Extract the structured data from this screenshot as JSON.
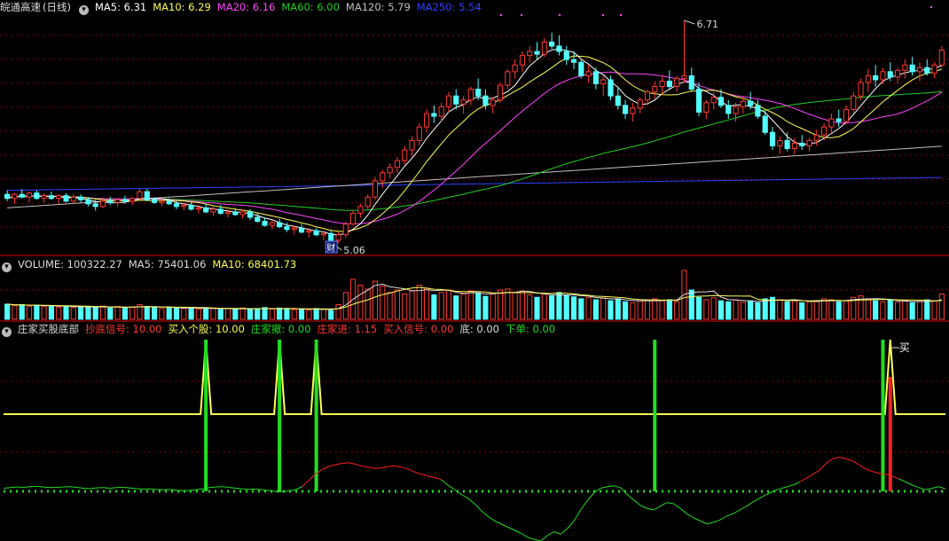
{
  "colors": {
    "up": "#ff3b30",
    "down": "#54ffff",
    "ma5": "#ffffff",
    "ma10": "#ffff55",
    "ma20": "#ff44ff",
    "ma60": "#22cc22",
    "ma120": "#c0c0c0",
    "ma250": "#3040ff",
    "grid": "#8b0000",
    "separator": "#b00000"
  },
  "price_panel": {
    "title": "皖通高速",
    "period": "(日线)",
    "ma": [
      {
        "label": "MA5: 6.31",
        "color": "#ffffff"
      },
      {
        "label": "MA10: 6.29",
        "color": "#ffff55"
      },
      {
        "label": "MA20: 6.16",
        "color": "#ff44ff"
      },
      {
        "label": "MA60: 6.00",
        "color": "#22cc22"
      },
      {
        "label": "MA120: 5.79",
        "color": "#c0c0c0"
      },
      {
        "label": "MA250: 5.54",
        "color": "#3040ff"
      }
    ],
    "high_label": "6.71",
    "low_label": "5.06",
    "event_label": "财"
  },
  "volume_panel": {
    "items": [
      {
        "label": "VOLUME: 100322.27",
        "color": "#dddddd"
      },
      {
        "label": "MA5: 75401.06",
        "color": "#dddddd"
      },
      {
        "label": "MA10: 68401.73",
        "color": "#ffff55"
      }
    ]
  },
  "indicator_panel": {
    "title": "庄家买股底部",
    "items": [
      {
        "label": "抄底信号: 10.00",
        "color": "#ff3b30"
      },
      {
        "label": "买入个股: 10.00",
        "color": "#ffff55"
      },
      {
        "label": "庄家撤: 0.00",
        "color": "#22dd22"
      },
      {
        "label": "庄家进: 1.15",
        "color": "#ff3b30"
      },
      {
        "label": "买入信号: 0.00",
        "color": "#ff3b30"
      },
      {
        "label": "底: 0.00",
        "color": "#dddddd"
      },
      {
        "label": "下单: 0.00",
        "color": "#22dd22"
      }
    ],
    "buy_label": "买"
  },
  "chart_data": {
    "type": "candlestick",
    "y_range": [
      5.0,
      6.75
    ],
    "candles": [
      [
        5.42,
        5.45,
        5.37,
        5.39
      ],
      [
        5.39,
        5.43,
        5.35,
        5.42
      ],
      [
        5.42,
        5.46,
        5.39,
        5.4
      ],
      [
        5.4,
        5.44,
        5.36,
        5.43
      ],
      [
        5.43,
        5.45,
        5.38,
        5.39
      ],
      [
        5.39,
        5.43,
        5.36,
        5.41
      ],
      [
        5.41,
        5.44,
        5.38,
        5.39
      ],
      [
        5.39,
        5.42,
        5.35,
        5.41
      ],
      [
        5.41,
        5.43,
        5.36,
        5.37
      ],
      [
        5.37,
        5.42,
        5.35,
        5.4
      ],
      [
        5.4,
        5.42,
        5.36,
        5.38
      ],
      [
        5.38,
        5.4,
        5.33,
        5.35
      ],
      [
        5.35,
        5.38,
        5.3,
        5.33
      ],
      [
        5.33,
        5.39,
        5.32,
        5.37
      ],
      [
        5.37,
        5.4,
        5.34,
        5.36
      ],
      [
        5.36,
        5.39,
        5.33,
        5.38
      ],
      [
        5.38,
        5.41,
        5.35,
        5.37
      ],
      [
        5.37,
        5.4,
        5.34,
        5.39
      ],
      [
        5.39,
        5.46,
        5.38,
        5.44
      ],
      [
        5.44,
        5.46,
        5.37,
        5.38
      ],
      [
        5.38,
        5.4,
        5.35,
        5.36
      ],
      [
        5.36,
        5.39,
        5.33,
        5.37
      ],
      [
        5.37,
        5.39,
        5.34,
        5.35
      ],
      [
        5.35,
        5.37,
        5.31,
        5.33
      ],
      [
        5.33,
        5.36,
        5.3,
        5.34
      ],
      [
        5.34,
        5.36,
        5.3,
        5.31
      ],
      [
        5.31,
        5.34,
        5.28,
        5.32
      ],
      [
        5.32,
        5.35,
        5.28,
        5.29
      ],
      [
        5.29,
        5.33,
        5.26,
        5.31
      ],
      [
        5.31,
        5.34,
        5.27,
        5.28
      ],
      [
        5.28,
        5.31,
        5.25,
        5.29
      ],
      [
        5.29,
        5.32,
        5.26,
        5.27
      ],
      [
        5.27,
        5.31,
        5.24,
        5.29
      ],
      [
        5.29,
        5.31,
        5.23,
        5.25
      ],
      [
        5.25,
        5.28,
        5.21,
        5.22
      ],
      [
        5.22,
        5.25,
        5.18,
        5.19
      ],
      [
        5.19,
        5.23,
        5.16,
        5.21
      ],
      [
        5.21,
        5.24,
        5.17,
        5.18
      ],
      [
        5.18,
        5.21,
        5.14,
        5.16
      ],
      [
        5.16,
        5.19,
        5.12,
        5.17
      ],
      [
        5.17,
        5.2,
        5.13,
        5.14
      ],
      [
        5.14,
        5.17,
        5.1,
        5.15
      ],
      [
        5.15,
        5.17,
        5.11,
        5.12
      ],
      [
        5.12,
        5.15,
        5.08,
        5.13
      ],
      [
        5.13,
        5.15,
        5.06,
        5.08
      ],
      [
        5.08,
        5.14,
        5.06,
        5.12
      ],
      [
        5.12,
        5.22,
        5.1,
        5.2
      ],
      [
        5.2,
        5.3,
        5.19,
        5.28
      ],
      [
        5.28,
        5.35,
        5.25,
        5.33
      ],
      [
        5.33,
        5.42,
        5.31,
        5.4
      ],
      [
        5.4,
        5.55,
        5.38,
        5.52
      ],
      [
        5.52,
        5.6,
        5.47,
        5.58
      ],
      [
        5.58,
        5.65,
        5.54,
        5.62
      ],
      [
        5.62,
        5.7,
        5.58,
        5.67
      ],
      [
        5.67,
        5.78,
        5.64,
        5.75
      ],
      [
        5.75,
        5.85,
        5.7,
        5.82
      ],
      [
        5.82,
        5.95,
        5.78,
        5.92
      ],
      [
        5.92,
        6.05,
        5.88,
        6.02
      ],
      [
        6.02,
        6.08,
        5.95,
        6.0
      ],
      [
        6.0,
        6.1,
        5.96,
        6.07
      ],
      [
        6.07,
        6.18,
        6.03,
        6.15
      ],
      [
        6.15,
        6.2,
        6.05,
        6.09
      ],
      [
        6.09,
        6.15,
        6.02,
        6.12
      ],
      [
        6.12,
        6.22,
        6.08,
        6.2
      ],
      [
        6.2,
        6.28,
        6.12,
        6.15
      ],
      [
        6.15,
        6.2,
        6.05,
        6.08
      ],
      [
        6.08,
        6.14,
        6.02,
        6.12
      ],
      [
        6.12,
        6.25,
        6.1,
        6.23
      ],
      [
        6.23,
        6.35,
        6.2,
        6.33
      ],
      [
        6.33,
        6.42,
        6.28,
        6.38
      ],
      [
        6.38,
        6.48,
        6.33,
        6.45
      ],
      [
        6.45,
        6.52,
        6.4,
        6.48
      ],
      [
        6.48,
        6.55,
        6.42,
        6.46
      ],
      [
        6.46,
        6.58,
        6.44,
        6.55
      ],
      [
        6.55,
        6.62,
        6.5,
        6.52
      ],
      [
        6.52,
        6.6,
        6.45,
        6.48
      ],
      [
        6.48,
        6.52,
        6.38,
        6.42
      ],
      [
        6.42,
        6.48,
        6.35,
        6.4
      ],
      [
        6.4,
        6.42,
        6.28,
        6.3
      ],
      [
        6.3,
        6.38,
        6.25,
        6.33
      ],
      [
        6.33,
        6.36,
        6.2,
        6.24
      ],
      [
        6.24,
        6.3,
        6.15,
        6.27
      ],
      [
        6.27,
        6.3,
        6.12,
        6.15
      ],
      [
        6.15,
        6.22,
        6.05,
        6.08
      ],
      [
        6.08,
        6.12,
        5.98,
        6.02
      ],
      [
        6.02,
        6.1,
        5.96,
        6.06
      ],
      [
        6.06,
        6.14,
        6.02,
        6.12
      ],
      [
        6.12,
        6.2,
        6.08,
        6.18
      ],
      [
        6.18,
        6.26,
        6.13,
        6.22
      ],
      [
        6.22,
        6.3,
        6.16,
        6.26
      ],
      [
        6.26,
        6.34,
        6.2,
        6.22
      ],
      [
        6.22,
        6.3,
        6.18,
        6.28
      ],
      [
        6.28,
        6.71,
        6.25,
        6.3
      ],
      [
        6.3,
        6.36,
        6.18,
        6.2
      ],
      [
        6.2,
        6.25,
        6.0,
        6.03
      ],
      [
        6.03,
        6.12,
        5.98,
        6.1
      ],
      [
        6.1,
        6.18,
        6.05,
        6.14
      ],
      [
        6.14,
        6.2,
        6.06,
        6.08
      ],
      [
        6.08,
        6.12,
        5.98,
        6.02
      ],
      [
        6.02,
        6.1,
        5.96,
        6.07
      ],
      [
        6.07,
        6.15,
        6.02,
        6.11
      ],
      [
        6.11,
        6.18,
        6.05,
        6.08
      ],
      [
        6.08,
        6.12,
        5.98,
        6.0
      ],
      [
        6.0,
        6.04,
        5.86,
        5.88
      ],
      [
        5.88,
        5.92,
        5.75,
        5.78
      ],
      [
        5.78,
        5.85,
        5.72,
        5.82
      ],
      [
        5.82,
        5.88,
        5.74,
        5.76
      ],
      [
        5.76,
        5.84,
        5.72,
        5.8
      ],
      [
        5.8,
        5.86,
        5.75,
        5.78
      ],
      [
        5.78,
        5.84,
        5.74,
        5.82
      ],
      [
        5.82,
        5.9,
        5.78,
        5.86
      ],
      [
        5.86,
        5.95,
        5.82,
        5.92
      ],
      [
        5.92,
        6.02,
        5.88,
        5.98
      ],
      [
        5.98,
        6.05,
        5.92,
        5.96
      ],
      [
        5.96,
        6.08,
        5.94,
        6.05
      ],
      [
        6.05,
        6.18,
        6.02,
        6.15
      ],
      [
        6.15,
        6.28,
        6.12,
        6.25
      ],
      [
        6.25,
        6.35,
        6.18,
        6.3
      ],
      [
        6.3,
        6.38,
        6.22,
        6.27
      ],
      [
        6.27,
        6.36,
        6.24,
        6.33
      ],
      [
        6.33,
        6.4,
        6.26,
        6.29
      ],
      [
        6.29,
        6.36,
        6.24,
        6.34
      ],
      [
        6.34,
        6.42,
        6.28,
        6.38
      ],
      [
        6.38,
        6.44,
        6.3,
        6.33
      ],
      [
        6.33,
        6.4,
        6.26,
        6.36
      ],
      [
        6.36,
        6.42,
        6.3,
        6.32
      ],
      [
        6.32,
        6.4,
        6.28,
        6.38
      ],
      [
        6.38,
        6.52,
        6.36,
        6.49
      ]
    ],
    "volume": [
      0.31,
      0.28,
      0.3,
      0.27,
      0.29,
      0.26,
      0.28,
      0.25,
      0.27,
      0.24,
      0.26,
      0.25,
      0.24,
      0.27,
      0.23,
      0.26,
      0.24,
      0.25,
      0.3,
      0.26,
      0.24,
      0.22,
      0.25,
      0.23,
      0.22,
      0.24,
      0.21,
      0.23,
      0.22,
      0.2,
      0.22,
      0.21,
      0.23,
      0.2,
      0.22,
      0.24,
      0.21,
      0.23,
      0.22,
      0.2,
      0.21,
      0.19,
      0.22,
      0.2,
      0.18,
      0.3,
      0.55,
      0.82,
      0.7,
      0.62,
      0.78,
      0.68,
      0.55,
      0.6,
      0.52,
      0.58,
      0.7,
      0.64,
      0.5,
      0.55,
      0.6,
      0.48,
      0.52,
      0.58,
      0.54,
      0.47,
      0.52,
      0.6,
      0.62,
      0.55,
      0.58,
      0.5,
      0.45,
      0.52,
      0.48,
      0.55,
      0.5,
      0.46,
      0.42,
      0.45,
      0.4,
      0.44,
      0.38,
      0.42,
      0.36,
      0.34,
      0.38,
      0.4,
      0.42,
      0.38,
      0.4,
      0.36,
      1.0,
      0.6,
      0.45,
      0.4,
      0.44,
      0.38,
      0.36,
      0.4,
      0.35,
      0.38,
      0.34,
      0.42,
      0.45,
      0.4,
      0.36,
      0.38,
      0.34,
      0.36,
      0.38,
      0.42,
      0.4,
      0.36,
      0.38,
      0.45,
      0.48,
      0.42,
      0.38,
      0.36,
      0.4,
      0.35,
      0.38,
      0.34,
      0.36,
      0.4,
      0.38,
      0.52
    ],
    "signals": [
      {
        "index": 27,
        "kind": "green"
      },
      {
        "index": 37,
        "kind": "green"
      },
      {
        "index": 42,
        "kind": "green"
      },
      {
        "index": 88,
        "kind": "green"
      },
      {
        "index": 119,
        "kind": "green"
      },
      {
        "index": 120,
        "kind": "red"
      }
    ],
    "oscillator": [
      0.1,
      0.12,
      0.14,
      0.13,
      0.15,
      0.16,
      0.14,
      0.12,
      0.13,
      0.14,
      0.15,
      0.13,
      0.1,
      0.09,
      0.11,
      0.12,
      0.1,
      0.12,
      0.13,
      0.11,
      0.09,
      0.07,
      0.08,
      0.06,
      0.05,
      0.06,
      0.04,
      0.02,
      0.03,
      0.05,
      0.08,
      0.12,
      0.14,
      0.15,
      0.13,
      0.1,
      0.08,
      0.06,
      0.07,
      0.05,
      0.03,
      0.0,
      -0.02,
      0.02,
      0.05,
      0.15,
      0.35,
      0.55,
      0.7,
      0.8,
      0.86,
      0.9,
      0.92,
      0.88,
      0.82,
      0.78,
      0.74,
      0.76,
      0.8,
      0.82,
      0.78,
      0.72,
      0.62,
      0.55,
      0.5,
      0.44,
      0.38,
      0.2,
      0.05,
      -0.1,
      -0.22,
      -0.4,
      -0.62,
      -0.8,
      -0.95,
      -1.05,
      -1.15,
      -1.25,
      -1.35,
      -1.48,
      -1.55,
      -1.6,
      -1.42,
      -1.3,
      -1.38,
      -1.2,
      -0.95,
      -0.6,
      -0.3,
      -0.05,
      0.1,
      0.15,
      0.18,
      0.12,
      -0.1,
      -0.28,
      -0.45,
      -0.55,
      -0.6,
      -0.48,
      -0.36,
      -0.4,
      -0.55,
      -0.72,
      -0.85,
      -0.95,
      -1.05,
      -1.0,
      -0.92,
      -0.8,
      -0.72,
      -0.6,
      -0.48,
      -0.34,
      -0.22,
      -0.1,
      0.0,
      0.08,
      0.14,
      0.2,
      0.3,
      0.42,
      0.55,
      0.68,
      0.9,
      1.05,
      1.1,
      1.05,
      0.98,
      0.85,
      0.72,
      0.64,
      0.58,
      0.55,
      0.48,
      0.4,
      0.3,
      0.2,
      0.12,
      0.05,
      0.1,
      0.15,
      0.08
    ]
  }
}
